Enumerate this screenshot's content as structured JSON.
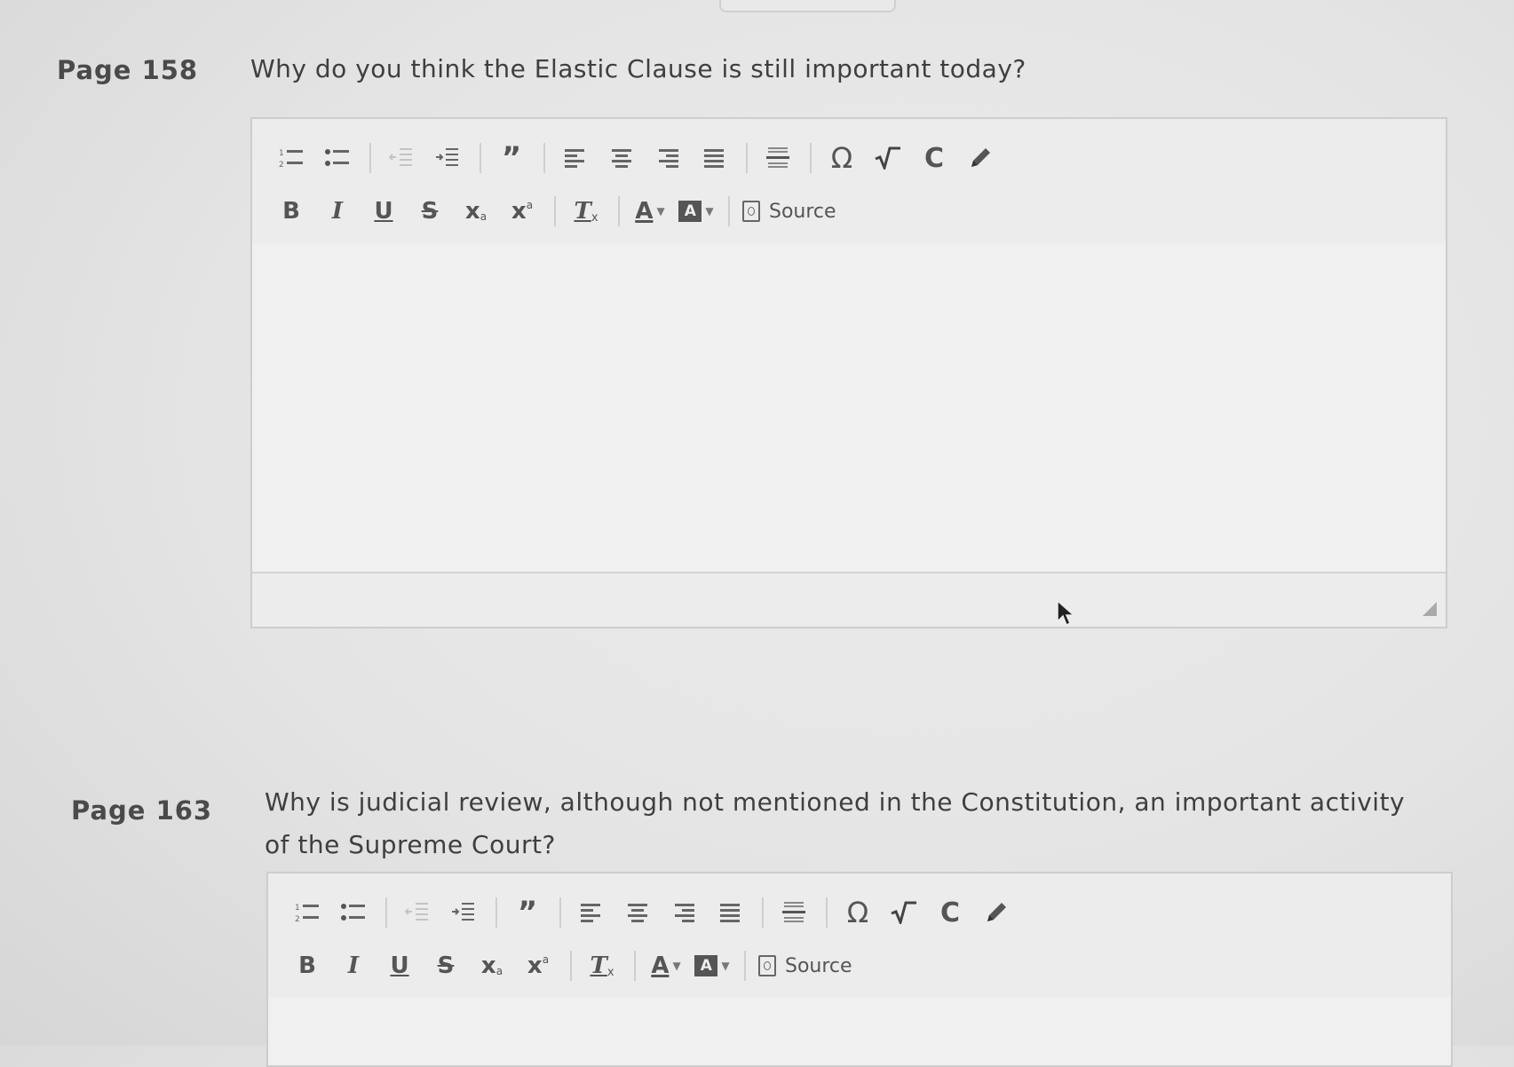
{
  "questions": [
    {
      "page_label": "Page 158",
      "prompt": "Why do you think the Elastic Clause is still important today?"
    },
    {
      "page_label": "Page 163",
      "prompt_line1": "Why is judicial review, although not mentioned in the Constitution, an important activity",
      "prompt_line2": "of the Supreme Court?"
    }
  ],
  "toolbar": {
    "row1_icons": [
      "numbered-list-icon",
      "bulleted-list-icon",
      "decrease-indent-icon",
      "increase-indent-icon",
      "blockquote-icon",
      "align-left-icon",
      "align-center-icon",
      "align-right-icon",
      "justify-icon",
      "horizontal-rule-icon",
      "special-character-icon",
      "math-icon",
      "copy-format-icon",
      "draw-icon"
    ],
    "bold": "B",
    "italic": "I",
    "underline": "U",
    "strike": "S",
    "subscript": "x",
    "superscript": "x",
    "remove_format": "T",
    "text_color": "A",
    "bg_color": "A",
    "source_label": "Source"
  }
}
